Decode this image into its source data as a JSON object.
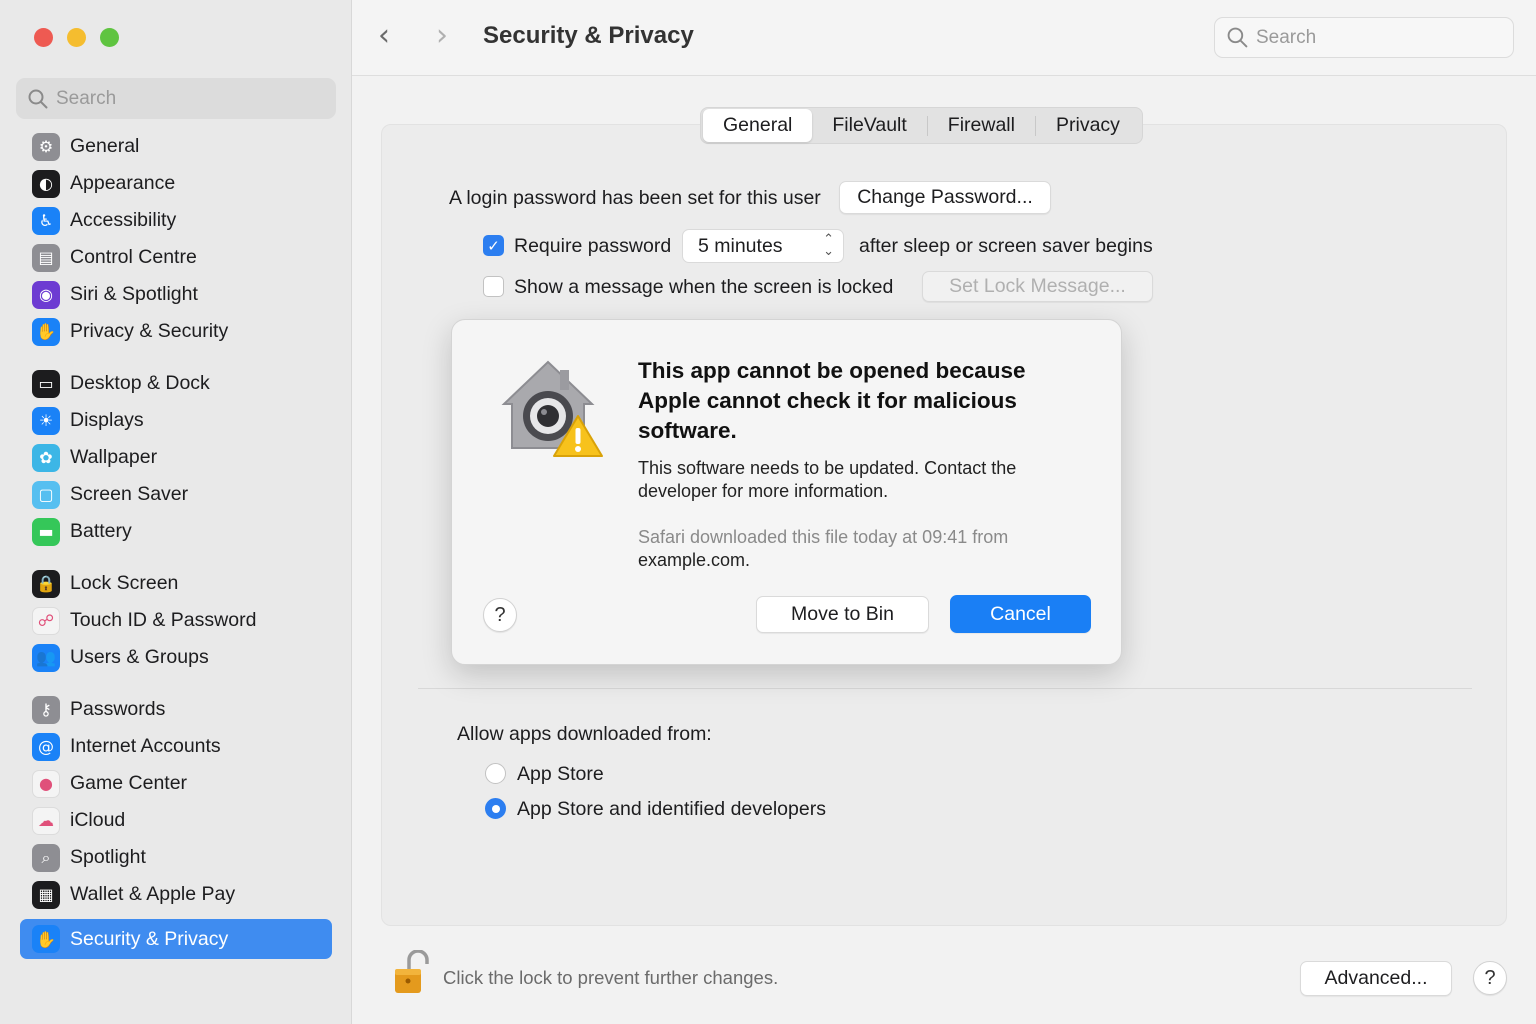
{
  "window": {
    "traffic_lights": {
      "close": "#ee5a52",
      "minimize": "#f5bd2f",
      "zoom": "#5fc440"
    }
  },
  "sidebar": {
    "search_placeholder": "Search",
    "items": [
      {
        "label": "General",
        "icon": "gear-icon",
        "color": "#8e8e93"
      },
      {
        "label": "Appearance",
        "icon": "appearance-icon",
        "color": "#1c1c1e"
      },
      {
        "label": "Accessibility",
        "icon": "accessibility-icon",
        "color": "#1a82f7"
      },
      {
        "label": "Control Centre",
        "icon": "control-centre-icon",
        "color": "#8e8e93"
      },
      {
        "label": "Siri & Spotlight",
        "icon": "siri-icon",
        "color": "#6d3bd2"
      },
      {
        "label": "Privacy & Security",
        "icon": "hand-icon",
        "color": "#1a82f7"
      },
      {
        "label": "Desktop & Dock",
        "icon": "dock-icon",
        "color": "#1c1c1e"
      },
      {
        "label": "Displays",
        "icon": "sun-icon",
        "color": "#1a82f7"
      },
      {
        "label": "Wallpaper",
        "icon": "flower-icon",
        "color": "#3cb6e6"
      },
      {
        "label": "Screen Saver",
        "icon": "screen-saver-icon",
        "color": "#56bff0"
      },
      {
        "label": "Battery",
        "icon": "battery-icon",
        "color": "#35c759"
      },
      {
        "label": "Lock Screen",
        "icon": "lock-icon",
        "color": "#1c1c1e"
      },
      {
        "label": "Touch ID & Password",
        "icon": "fingerprint-icon",
        "color": "#f4f4f4"
      },
      {
        "label": "Users & Groups",
        "icon": "users-icon",
        "color": "#1a82f7"
      },
      {
        "label": "Passwords",
        "icon": "key-icon",
        "color": "#8e8e93"
      },
      {
        "label": "Internet Accounts",
        "icon": "at-icon",
        "color": "#1a82f7"
      },
      {
        "label": "Game Center",
        "icon": "game-center-icon",
        "color": "#f4f4f4"
      },
      {
        "label": "iCloud",
        "icon": "cloud-icon",
        "color": "#f4f4f4"
      },
      {
        "label": "Spotlight",
        "icon": "magnifier-icon",
        "color": "#8e8e93"
      },
      {
        "label": "Wallet & Apple Pay",
        "icon": "wallet-icon",
        "color": "#1c1c1e"
      },
      {
        "label": "Security & Privacy",
        "icon": "hand-icon",
        "color": "#1a82f7",
        "selected": true
      }
    ]
  },
  "toolbar": {
    "title": "Security & Privacy",
    "search_placeholder": "Search"
  },
  "tabs": [
    {
      "label": "General",
      "active": true
    },
    {
      "label": "FileVault"
    },
    {
      "label": "Firewall"
    },
    {
      "label": "Privacy"
    }
  ],
  "general": {
    "password_text": "A login password has been set for this user",
    "change_password_label": "Change Password...",
    "require_password_label": "Require password",
    "require_password_checked": true,
    "delay_value": "5 minutes",
    "after_sleep_text": "after sleep or screen saver begins",
    "show_message_label": "Show a message when the screen is locked",
    "show_message_checked": false,
    "set_lock_message_label": "Set Lock Message...",
    "allow_apps_label": "Allow apps downloaded from:",
    "options": [
      {
        "label": "App Store",
        "selected": false
      },
      {
        "label": "App Store and identified developers",
        "selected": true
      }
    ]
  },
  "dialog": {
    "title": "This app cannot be opened because Apple cannot check it for malicious software.",
    "body": "This software needs to be updated. Contact the developer for more information.",
    "meta_prefix": "Safari downloaded this file today at 09:41 from",
    "meta_domain": "example.com.",
    "help_label": "?",
    "move_to_bin_label": "Move to Bin",
    "cancel_label": "Cancel"
  },
  "footer": {
    "lock_text": "Click the lock to prevent further changes.",
    "advanced_label": "Advanced...",
    "help_label": "?"
  }
}
